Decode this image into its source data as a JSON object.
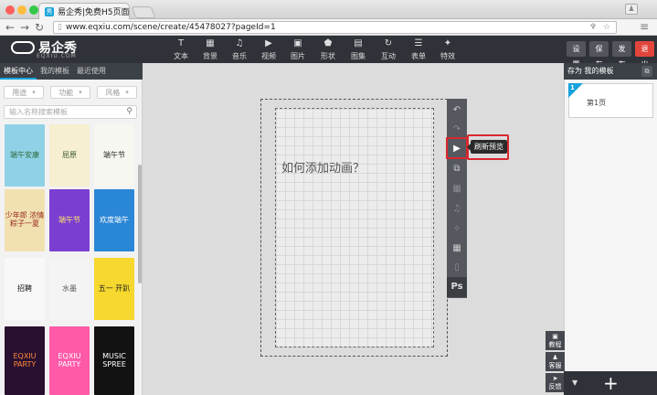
{
  "browser": {
    "tab_title": "易企秀|免费H5页面微场景制作",
    "tab_favicon": "秀",
    "tab_close": "✕",
    "url": "www.eqxiu.com/scene/create/45478027?pageId=1",
    "url_right_icons": "♆ ☆",
    "nav_back": "←",
    "nav_forward": "→",
    "nav_reload": "↻",
    "menu": "≡"
  },
  "app": {
    "logo_text": "易企秀",
    "logo_sub": "EQXIU.COM",
    "tools": [
      {
        "label": "文本",
        "icon": "T"
      },
      {
        "label": "背景",
        "icon": "▦"
      },
      {
        "label": "音乐",
        "icon": "♫"
      },
      {
        "label": "视频",
        "icon": "▶"
      },
      {
        "label": "图片",
        "icon": "▣"
      },
      {
        "label": "形状",
        "icon": "⬟"
      },
      {
        "label": "图集",
        "icon": "▤"
      },
      {
        "label": "互动",
        "icon": "↻"
      },
      {
        "label": "表单",
        "icon": "☰"
      },
      {
        "label": "特效",
        "icon": "✦"
      }
    ],
    "buttons": {
      "settings": "设置",
      "save": "保存",
      "publish": "发布",
      "exit": "退出"
    }
  },
  "left_panel": {
    "tabs": [
      "模板中心",
      "我的模板",
      "最近使用"
    ],
    "filters": [
      "用途",
      "功能",
      "风格"
    ],
    "search_placeholder": "输入名称搜索模板",
    "templates": [
      {
        "text": "端午安康",
        "bg": "#8fd1e6",
        "fg": "#2d6a3d"
      },
      {
        "text": "屈原",
        "bg": "#f6efd0",
        "fg": "#3b5d33"
      },
      {
        "text": "端午节",
        "bg": "#f7f7f2",
        "fg": "#2b2b2b"
      },
      {
        "text": "少年郎 浓情粽子一夏",
        "bg": "#f1e0b0",
        "fg": "#9a2c1f"
      },
      {
        "text": "端午节",
        "bg": "#7a3fd1",
        "fg": "#ffe36b"
      },
      {
        "text": "欢度端午",
        "bg": "#2a86d6",
        "fg": "#ffffff"
      },
      {
        "text": "招聘",
        "bg": "#f8f8f8",
        "fg": "#111111"
      },
      {
        "text": "水墨",
        "bg": "#f4f4f4",
        "fg": "#555555"
      },
      {
        "text": "五一 开趴",
        "bg": "#f6d82e",
        "fg": "#1f1f1f"
      },
      {
        "text": "EQXIU PARTY",
        "bg": "#2a1030",
        "fg": "#ff8a3d"
      },
      {
        "text": "EQXIU PARTY",
        "bg": "#ff5aa8",
        "fg": "#ffffff"
      },
      {
        "text": "MUSIC SPREE",
        "bg": "#121212",
        "fg": "#ffffff"
      }
    ]
  },
  "canvas": {
    "text": "如何添加动画？"
  },
  "vertical_toolbar": {
    "items": [
      "↶",
      "↷",
      "▶",
      "⧉",
      "▦",
      "♫",
      "✧",
      "▦",
      "▯"
    ],
    "ps": "Ps",
    "tooltip": "刷新预览"
  },
  "right_panel": {
    "header": "存为 我的模板",
    "header_icon": "⧉",
    "page_number": "1",
    "page_label": "第1页",
    "helpers": [
      {
        "icon": "▣",
        "label": "教程"
      },
      {
        "icon": "♟",
        "label": "客服"
      },
      {
        "icon": "➤",
        "label": "反馈"
      }
    ],
    "add": "+",
    "caret": "▼"
  },
  "colors": {
    "accent": "#16a2dc",
    "highlight": "#d9272e",
    "exit_button": "#e2453c",
    "appbar": "#2f3238"
  }
}
